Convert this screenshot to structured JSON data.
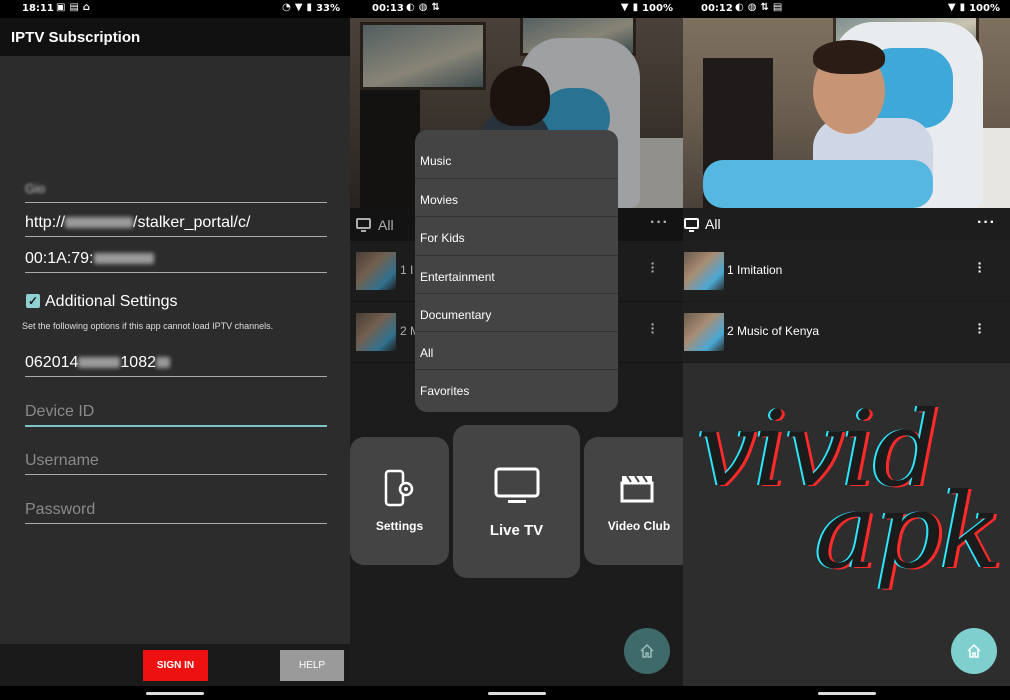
{
  "panel1": {
    "status": {
      "time": "18:11",
      "battery": "33%"
    },
    "title": "IPTV Subscription",
    "fields": {
      "name_visible": "Gio",
      "url_prefix": "http://",
      "url_suffix": "/stalker_portal/c/",
      "mac_prefix": "00:1A:79:",
      "serial_prefix": "062014",
      "serial_mid": "1082"
    },
    "additional_settings_label": "Additional Settings",
    "hint": "Set the following options if this app cannot load IPTV channels.",
    "placeholders": {
      "device_id": "Device ID",
      "username": "Username",
      "password": "Password"
    },
    "buttons": {
      "sign_in": "SIGN IN",
      "help": "HELP"
    }
  },
  "panel2": {
    "status": {
      "time": "00:13",
      "battery": "100%"
    },
    "header": {
      "label": "All"
    },
    "rows": [
      {
        "label": "1 I"
      },
      {
        "label": "2 M"
      }
    ],
    "menu": [
      "Music",
      "Movies",
      "For Kids",
      "Entertainment",
      "Documentary",
      "All",
      "Favorites"
    ],
    "tiles": {
      "settings": "Settings",
      "live_tv": "Live TV",
      "video_club": "Video Club"
    }
  },
  "panel3": {
    "status": {
      "time": "00:12",
      "battery": "100%"
    },
    "header": {
      "label": "All"
    },
    "rows": [
      {
        "label": "1 Imitation"
      },
      {
        "label": "2 Music of Kenya"
      }
    ],
    "watermark": {
      "line1": "vivid",
      "line2": "apk"
    }
  },
  "colors": {
    "accent_teal": "#8fd0d3",
    "sign_in_red": "#ee1111",
    "fab_teal": "#7fcfcf"
  },
  "icons": [
    "checkbox-icon",
    "tv-icon",
    "more-horizontal-icon",
    "more-vertical-icon",
    "phone-settings-icon",
    "monitor-icon",
    "clapperboard-icon",
    "home-icon",
    "wifi-icon",
    "battery-icon"
  ]
}
